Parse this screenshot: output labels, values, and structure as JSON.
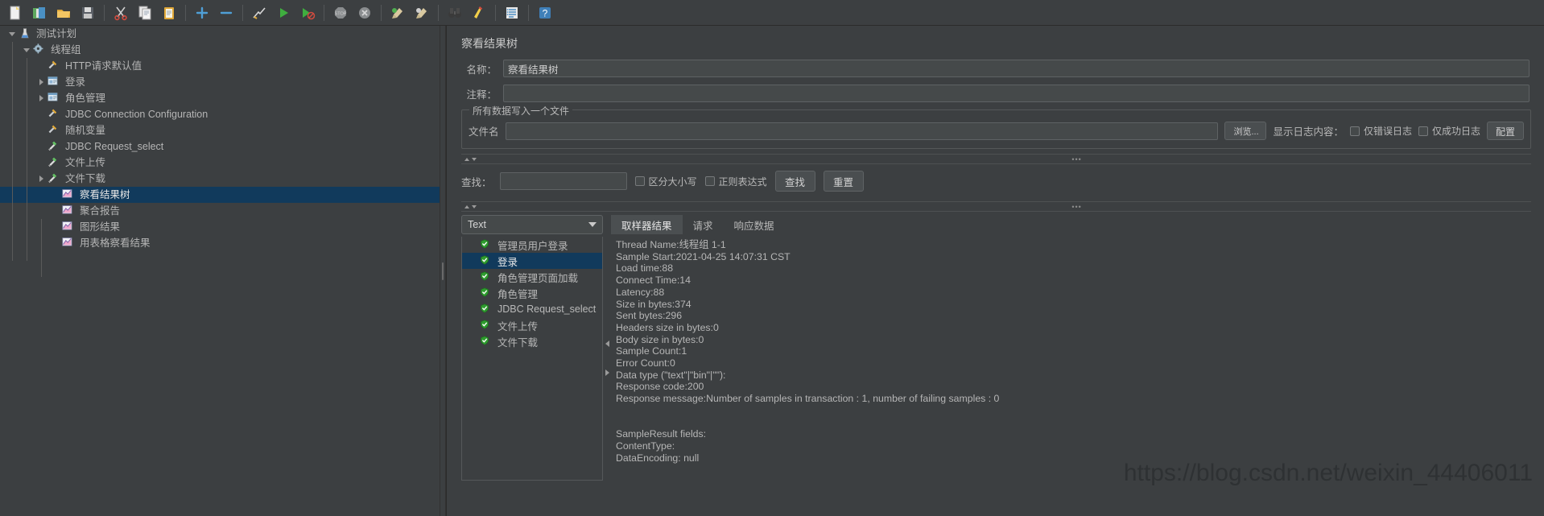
{
  "toolbar": {
    "buttons": [
      {
        "name": "new-test-plan",
        "icon": "new-document-icon"
      },
      {
        "name": "templates",
        "icon": "templates-icon"
      },
      {
        "name": "open",
        "icon": "open-folder-icon"
      },
      {
        "name": "save",
        "icon": "save-disk-icon"
      },
      {
        "name": "cut",
        "icon": "scissors-icon"
      },
      {
        "name": "copy",
        "icon": "copy-icon"
      },
      {
        "name": "paste",
        "icon": "clipboard-icon"
      },
      {
        "name": "expand-all",
        "icon": "plus-icon"
      },
      {
        "name": "collapse-all",
        "icon": "minus-icon"
      },
      {
        "name": "toggle",
        "icon": "toggle-pencil-icon"
      },
      {
        "name": "start",
        "icon": "play-green-icon"
      },
      {
        "name": "start-no-pauses",
        "icon": "play-no-pause-icon"
      },
      {
        "name": "stop",
        "icon": "stop-sign-icon"
      },
      {
        "name": "shutdown",
        "icon": "shutdown-x-icon"
      },
      {
        "name": "clear",
        "icon": "broom-green-icon"
      },
      {
        "name": "clear-all",
        "icon": "broom-gray-icon"
      },
      {
        "name": "search",
        "icon": "binoculars-icon"
      },
      {
        "name": "reset-search",
        "icon": "yellow-broom-icon"
      },
      {
        "name": "function-helper",
        "icon": "list-lines-icon"
      },
      {
        "name": "help",
        "icon": "help-question-icon"
      }
    ]
  },
  "tree": {
    "nodes": [
      {
        "label": "测试计划",
        "depth": 0,
        "toggle": "open",
        "icon": "test-plan-icon",
        "selected": false
      },
      {
        "label": "线程组",
        "depth": 1,
        "toggle": "open",
        "icon": "thread-group-icon",
        "selected": false
      },
      {
        "label": "HTTP请求默认值",
        "depth": 2,
        "toggle": "none",
        "icon": "config-wrench-icon",
        "selected": false
      },
      {
        "label": "登录",
        "depth": 2,
        "toggle": "closed",
        "icon": "controller-icon",
        "selected": false
      },
      {
        "label": "角色管理",
        "depth": 2,
        "toggle": "closed",
        "icon": "controller-icon",
        "selected": false
      },
      {
        "label": "JDBC Connection Configuration",
        "depth": 2,
        "toggle": "none",
        "icon": "config-wrench-icon",
        "selected": false
      },
      {
        "label": "随机变量",
        "depth": 2,
        "toggle": "none",
        "icon": "config-wrench-icon",
        "selected": false
      },
      {
        "label": "JDBC Request_select",
        "depth": 2,
        "toggle": "none",
        "icon": "sampler-pipette-icon",
        "selected": false
      },
      {
        "label": "文件上传",
        "depth": 2,
        "toggle": "none",
        "icon": "sampler-pipette-icon",
        "selected": false
      },
      {
        "label": "文件下载",
        "depth": 2,
        "toggle": "closed",
        "icon": "sampler-pipette-icon",
        "selected": false
      },
      {
        "label": "察看结果树",
        "depth": 3,
        "toggle": "none",
        "icon": "listener-chart-icon",
        "selected": true
      },
      {
        "label": "聚合报告",
        "depth": 3,
        "toggle": "none",
        "icon": "listener-chart-icon",
        "selected": false
      },
      {
        "label": "图形结果",
        "depth": 3,
        "toggle": "none",
        "icon": "listener-chart-icon",
        "selected": false
      },
      {
        "label": "用表格察看结果",
        "depth": 3,
        "toggle": "none",
        "icon": "listener-chart-icon",
        "selected": false
      }
    ]
  },
  "panel": {
    "title": "察看结果树",
    "name_label": "名称：",
    "name_value": "察看结果树",
    "comment_label": "注释：",
    "comment_value": "",
    "group_title": "所有数据写入一个文件",
    "filename_label": "文件名",
    "filename_value": "",
    "browse_button": "浏览...",
    "log_display_label": "显示日志内容：",
    "errors_only_label": "仅错误日志",
    "success_only_label": "仅成功日志",
    "configure_button": "配置"
  },
  "search": {
    "label": "查找：",
    "value": "",
    "case_sensitive_label": "区分大小写",
    "regex_label": "正则表达式",
    "find_button": "查找",
    "reset_button": "重置"
  },
  "results": {
    "renderer_selected": "Text",
    "items": [
      {
        "label": "管理员用户登录",
        "status": "success",
        "selected": false
      },
      {
        "label": "登录",
        "status": "success",
        "selected": true
      },
      {
        "label": "角色管理页面加载",
        "status": "success",
        "selected": false
      },
      {
        "label": "角色管理",
        "status": "success",
        "selected": false
      },
      {
        "label": "JDBC Request_select",
        "status": "success",
        "selected": false
      },
      {
        "label": "文件上传",
        "status": "success",
        "selected": false
      },
      {
        "label": "文件下载",
        "status": "success",
        "selected": false
      }
    ],
    "tabs": [
      {
        "label": "取样器结果",
        "active": true
      },
      {
        "label": "请求",
        "active": false
      },
      {
        "label": "响应数据",
        "active": false
      }
    ],
    "detail_text": "Thread Name:线程组 1-1\nSample Start:2021-04-25 14:07:31 CST\nLoad time:88\nConnect Time:14\nLatency:88\nSize in bytes:374\nSent bytes:296\nHeaders size in bytes:0\nBody size in bytes:0\nSample Count:1\nError Count:0\nData type (\"text\"|\"bin\"|\"\"):\nResponse code:200\nResponse message:Number of samples in transaction : 1, number of failing samples : 0\n\n\nSampleResult fields:\nContentType:\nDataEncoding: null"
  },
  "watermark": "https://blog.csdn.net/weixin_44406011",
  "colors": {
    "background": "#3c3f41",
    "selection": "#113a5c",
    "text": "#b5b5b5",
    "success_green": "#3ca83c"
  }
}
